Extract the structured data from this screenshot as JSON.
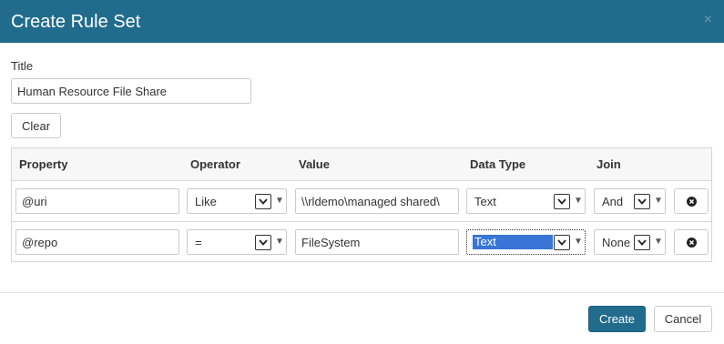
{
  "dialog": {
    "title": "Create Rule Set",
    "close_glyph": "×"
  },
  "form": {
    "title_label": "Title",
    "title_value": "Human Resource File Share",
    "clear_label": "Clear"
  },
  "table": {
    "columns": [
      "Property",
      "Operator",
      "Value",
      "Data Type",
      "Join"
    ],
    "rows": [
      {
        "property": "@uri",
        "operator": "Like",
        "value": "\\\\rldemo\\managed shared\\",
        "data_type": "Text",
        "join": "And"
      },
      {
        "property": "@repo",
        "operator": "=",
        "value": "FileSystem",
        "data_type": "Text",
        "join": "None"
      }
    ]
  },
  "footer": {
    "create_label": "Create",
    "cancel_label": "Cancel"
  },
  "colors": {
    "header_bg": "#216c8c",
    "primary_button": "#216c8c",
    "selection_highlight": "#3875d7"
  },
  "icons": {
    "close": "close-icon",
    "dropdown": "chevron-down-icon",
    "remove": "remove-circle-icon"
  }
}
